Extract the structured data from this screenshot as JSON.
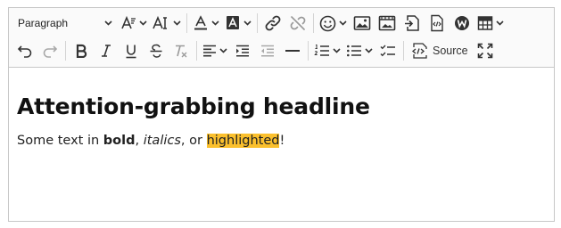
{
  "toolbar": {
    "heading_select": {
      "value": "Paragraph"
    },
    "source_label": "Source"
  },
  "content": {
    "headline": "Attention-grabbing headline",
    "paragraph": {
      "t1": "Some text in ",
      "bold": "bold",
      "t2": ", ",
      "italic": "italics",
      "t3": ", or ",
      "highlighted": "highlighted",
      "t4": "!"
    }
  },
  "colors": {
    "highlight": "#fbc02d",
    "toolbar_bg": "#fafafa",
    "border": "#c7c7c7"
  }
}
